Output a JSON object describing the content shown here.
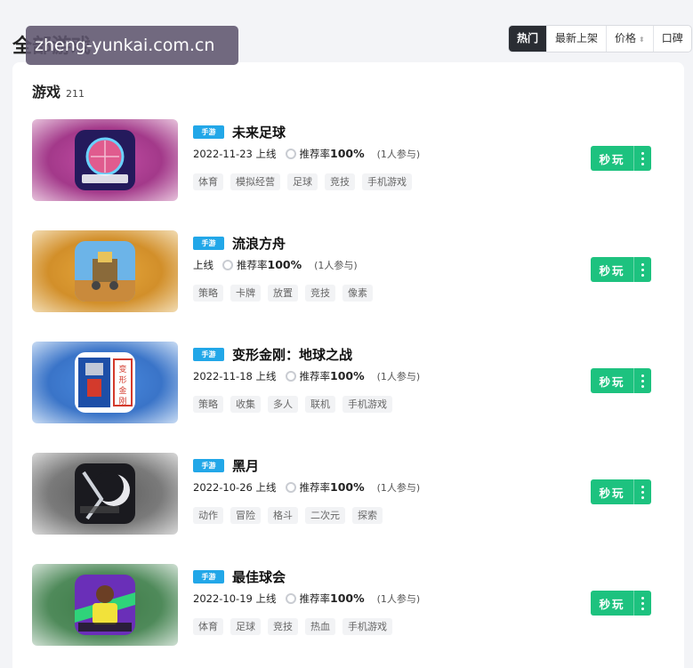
{
  "page": {
    "title": "全部游戏"
  },
  "watermark": "zheng-yunkai.com.cn",
  "sort_tabs": [
    {
      "label": "热门",
      "active": true
    },
    {
      "label": "最新上架",
      "active": false
    },
    {
      "label": "价格",
      "active": false,
      "sortable": true
    },
    {
      "label": "口碑",
      "active": false
    }
  ],
  "section": {
    "title": "游戏",
    "count": "211"
  },
  "badge_label": "手游",
  "play_label": "秒玩",
  "games": [
    {
      "name": "未来足球",
      "date": "2022-11-23 上线",
      "rec_prefix": "推荐率",
      "rec_value": "100%",
      "join": "(1人参与)",
      "tags": [
        "体育",
        "模拟经营",
        "足球",
        "竞技",
        "手机游戏"
      ],
      "bg": "#b7458f",
      "icon": "soccer"
    },
    {
      "name": "流浪方舟",
      "date": "上线",
      "rec_prefix": "推荐率",
      "rec_value": "100%",
      "join": "(1人参与)",
      "tags": [
        "策略",
        "卡牌",
        "放置",
        "竞技",
        "像素"
      ],
      "bg": "#d8992f",
      "icon": "ark"
    },
    {
      "name": "变形金刚：地球之战",
      "date": "2022-11-18 上线",
      "rec_prefix": "推荐率",
      "rec_value": "100%",
      "join": "(1人参与)",
      "tags": [
        "策略",
        "收集",
        "多人",
        "联机",
        "手机游戏"
      ],
      "bg": "#3f7fd6",
      "icon": "robot"
    },
    {
      "name": "黑月",
      "date": "2022-10-26 上线",
      "rec_prefix": "推荐率",
      "rec_value": "100%",
      "join": "(1人参与)",
      "tags": [
        "动作",
        "冒险",
        "格斗",
        "二次元",
        "探索"
      ],
      "bg": "#6e6e6e",
      "icon": "moon"
    },
    {
      "name": "最佳球会",
      "date": "2022-10-19 上线",
      "rec_prefix": "推荐率",
      "rec_value": "100%",
      "join": "(1人参与)",
      "tags": [
        "体育",
        "足球",
        "竞技",
        "热血",
        "手机游戏"
      ],
      "bg": "#3f7f4a",
      "icon": "club"
    }
  ]
}
